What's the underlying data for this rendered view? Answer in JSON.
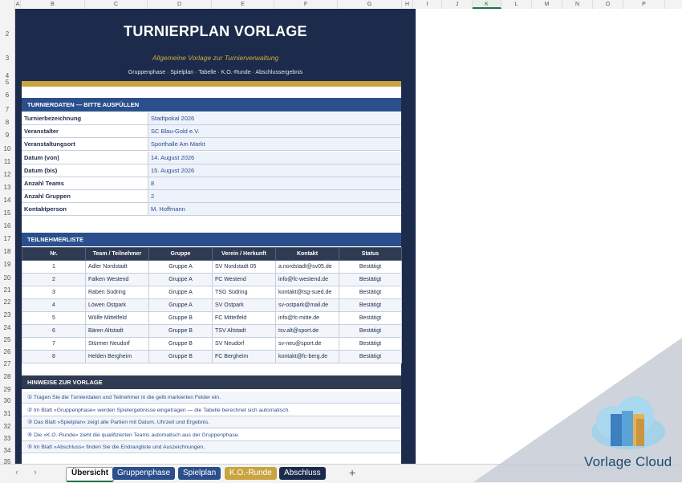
{
  "columns": [
    "A",
    "B",
    "C",
    "D",
    "E",
    "F",
    "G",
    "H",
    "I",
    "J",
    "K",
    "L",
    "M",
    "N",
    "O",
    "P"
  ],
  "active_column": "K",
  "rows": [
    "2",
    "3",
    "4",
    "5",
    "6",
    "7",
    "8",
    "9",
    "10",
    "11",
    "12",
    "13",
    "14",
    "15",
    "16",
    "17",
    "18",
    "19",
    "20",
    "21",
    "22",
    "23",
    "24",
    "25",
    "26",
    "27",
    "28",
    "29",
    "30",
    "31",
    "32",
    "33",
    "34",
    "35",
    "36"
  ],
  "header": {
    "title": "TURNIERPLAN VORLAGE",
    "subtitle": "Allgemeine Vorlage zur Turnierverwaltung",
    "tagline": "Gruppenphase · Spielplan · Tabelle · K.O.-Runde · Abschlussergebnis"
  },
  "turnierdaten": {
    "heading": "TURNIERDATEN — BITTE AUSFÜLLEN",
    "fields": [
      {
        "label": "Turnierbezeichnung",
        "value": "Stadtpokal 2026"
      },
      {
        "label": "Veranstalter",
        "value": "SC Blau-Gold e.V."
      },
      {
        "label": "Veranstaltungsort",
        "value": "Sporthalle Am Markt"
      },
      {
        "label": "Datum (von)",
        "value": "14. August 2026"
      },
      {
        "label": "Datum (bis)",
        "value": "15. August 2026"
      },
      {
        "label": "Anzahl Teams",
        "value": "8"
      },
      {
        "label": "Anzahl Gruppen",
        "value": "2"
      },
      {
        "label": "Kontaktperson",
        "value": "M. Hoffmann"
      }
    ]
  },
  "teilnehmer": {
    "heading": "TEILNEHMERLISTE",
    "columns": [
      "Nr.",
      "Team / Teilnehmer",
      "Gruppe",
      "Verein / Herkunft",
      "Kontakt",
      "Status"
    ],
    "rows": [
      [
        "1",
        "Adler Nordstadt",
        "Gruppe A",
        "SV Nordstadt 05",
        "a.nordstadt@sv05.de",
        "Bestätigt"
      ],
      [
        "2",
        "Falken Westend",
        "Gruppe A",
        "FC Westend",
        "info@fc-westend.de",
        "Bestätigt"
      ],
      [
        "3",
        "Raben Südring",
        "Gruppe A",
        "TSG Südring",
        "kontakt@tsg-sued.de",
        "Bestätigt"
      ],
      [
        "4",
        "Löwen Ostpark",
        "Gruppe A",
        "SV Ostpark",
        "sv-ostpark@mail.de",
        "Bestätigt"
      ],
      [
        "5",
        "Wölfe Mittelfeld",
        "Gruppe B",
        "FC Mittelfeld",
        "info@fc-mitte.de",
        "Bestätigt"
      ],
      [
        "6",
        "Bären Altstadt",
        "Gruppe B",
        "TSV Altstadt",
        "tsv.alt@sport.de",
        "Bestätigt"
      ],
      [
        "7",
        "Stürmer Neudorf",
        "Gruppe B",
        "SV Neudorf",
        "sv-neu@sport.de",
        "Bestätigt"
      ],
      [
        "8",
        "Helden Bergheim",
        "Gruppe B",
        "FC Bergheim",
        "kontakt@fc-berg.de",
        "Bestätigt"
      ]
    ]
  },
  "hinweise": {
    "heading": "HINWEISE ZUR VORLAGE",
    "items": [
      "① Tragen Sie die Turnierdaten und Teilnehmer in die gelb markierten Felder ein.",
      "② Im Blatt »Gruppenphase« werden Spielergebnisse eingetragen — die Tabelle berechnet sich automatisch.",
      "③ Das Blatt »Spielplan« zeigt alle Partien mit Datum, Uhrzeit und Ergebnis.",
      "④ Die »K.O.-Runde« zieht die qualifizierten Teams automatisch aus der Gruppenphase.",
      "⑤ Im Blatt »Abschluss« finden Sie die Endrangliste und Auszeichnungen."
    ]
  },
  "tabs": [
    {
      "label": "Übersicht",
      "active": true,
      "color": "#ffffff"
    },
    {
      "label": "Gruppenphase",
      "active": false,
      "color": "#2b4f8c"
    },
    {
      "label": "Spielplan",
      "active": false,
      "color": "#2b4f8c"
    },
    {
      "label": "K.O.-Runde",
      "active": false,
      "color": "#c9a441"
    },
    {
      "label": "Abschluss",
      "active": false,
      "color": "#1c2b4b"
    }
  ],
  "nav": {
    "prev": "‹",
    "next": "›",
    "add": "+"
  },
  "watermark": {
    "text": "Vorlage Cloud"
  },
  "colors": {
    "navy": "#1c2b4b",
    "blue": "#2b4f8c",
    "gold": "#c9a441",
    "excel_green": "#1e7145"
  }
}
